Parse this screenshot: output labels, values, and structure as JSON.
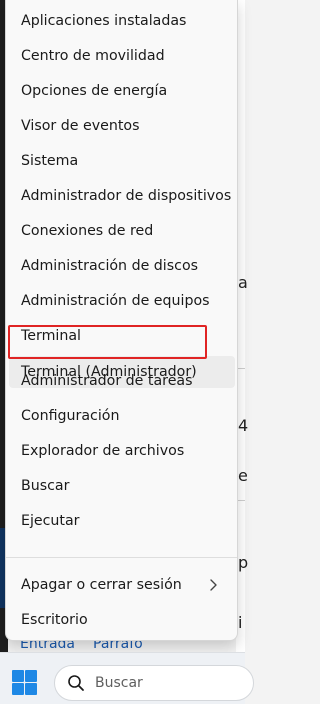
{
  "menu": {
    "items": [
      {
        "label": "Aplicaciones instaladas"
      },
      {
        "label": "Centro de movilidad"
      },
      {
        "label": "Opciones de energía"
      },
      {
        "label": "Visor de eventos"
      },
      {
        "label": "Sistema"
      },
      {
        "label": "Administrador de dispositivos"
      },
      {
        "label": "Conexiones de red"
      },
      {
        "label": "Administración de discos"
      },
      {
        "label": "Administración de equipos"
      },
      {
        "label": "Terminal"
      },
      {
        "label": "Terminal (Administrador)",
        "highlighted": true
      },
      {
        "label": "Administrador de tareas"
      },
      {
        "label": "Configuración"
      },
      {
        "label": "Explorador de archivos"
      },
      {
        "label": "Buscar"
      },
      {
        "label": "Ejecutar"
      },
      {
        "label": "Apagar o cerrar sesión",
        "has_submenu": true
      },
      {
        "label": "Escritorio"
      }
    ]
  },
  "background": {
    "fragments": [
      "a",
      "4",
      "e",
      "p",
      "i"
    ],
    "bottom_tabs": [
      "Entrada",
      "Parrafo"
    ]
  },
  "taskbar": {
    "search_placeholder": "Buscar",
    "start_icon": "windows-logo-icon",
    "search_icon": "search-icon"
  },
  "colors": {
    "highlight_border": "#e02424",
    "start_blue": "#1e88e5",
    "menu_bg": "#f9f9f9"
  }
}
